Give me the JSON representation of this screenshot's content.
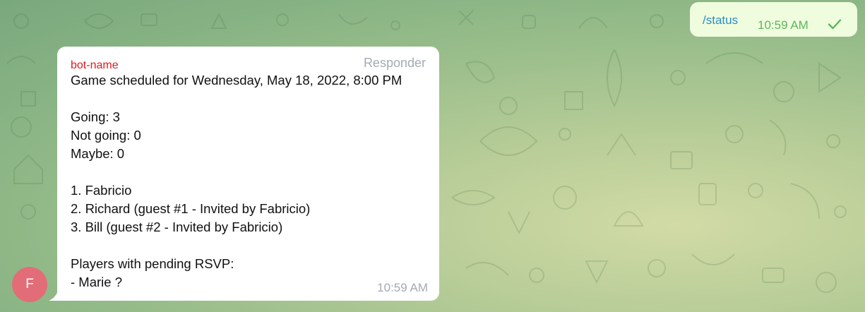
{
  "outgoing": {
    "text": "/status",
    "time": "10:59 AM",
    "status_icon": "single-check-icon"
  },
  "incoming": {
    "sender": "bot-name",
    "role": "Responder",
    "lines": [
      "Game scheduled for Wednesday, May 18, 2022, 8:00 PM",
      "",
      "Going: 3",
      "Not going: 0",
      "Maybe: 0",
      "",
      "1. Fabricio",
      "2. Richard (guest #1 - Invited by Fabricio)",
      "3. Bill (guest #2 - Invited by Fabricio)",
      "",
      "Players with pending RSVP:",
      "- Marie ?"
    ],
    "time": "10:59 AM"
  },
  "avatar": {
    "initial": "F",
    "color": "#e26d78"
  },
  "colors": {
    "sender_name": "#e3191b",
    "outgoing_bubble": "#effdde",
    "outgoing_text": "#2e8bc8",
    "outgoing_time": "#5eb55c",
    "muted": "#a4abb3"
  }
}
